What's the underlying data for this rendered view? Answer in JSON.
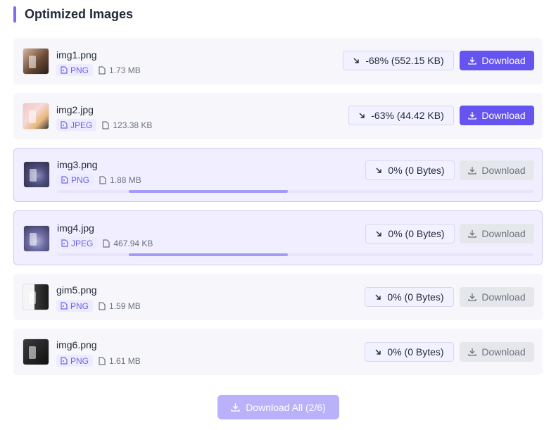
{
  "header": {
    "title": "Optimized Images"
  },
  "images": [
    {
      "name": "img1.png",
      "format": "PNG",
      "size": "1.73 MB",
      "ratio": "-68% (552.15 KB)",
      "download_label": "Download",
      "status": "done",
      "thumb_icon": "image-thumbnail"
    },
    {
      "name": "img2.jpg",
      "format": "JPEG",
      "size": "123.38 KB",
      "ratio": "-63% (44.42 KB)",
      "download_label": "Download",
      "status": "done",
      "thumb_icon": "image-thumbnail"
    },
    {
      "name": "img3.png",
      "format": "PNG",
      "size": "1.88 MB",
      "ratio": "0% (0 Bytes)",
      "download_label": "Download",
      "status": "processing",
      "thumb_icon": "image-thumbnail"
    },
    {
      "name": "img4.jpg",
      "format": "JPEG",
      "size": "467.94 KB",
      "ratio": "0% (0 Bytes)",
      "download_label": "Download",
      "status": "processing",
      "thumb_icon": "image-thumbnail"
    },
    {
      "name": "gim5.png",
      "format": "PNG",
      "size": "1.59 MB",
      "ratio": "0% (0 Bytes)",
      "download_label": "Download",
      "status": "pending",
      "thumb_icon": "image-thumbnail"
    },
    {
      "name": "img6.png",
      "format": "PNG",
      "size": "1.61 MB",
      "ratio": "0% (0 Bytes)",
      "download_label": "Download",
      "status": "pending",
      "thumb_icon": "image-thumbnail"
    }
  ],
  "footer": {
    "download_all_label": "Download All (2/6)"
  },
  "colors": {
    "accent": "#6554ef",
    "accent_light": "#b9b2fb",
    "badge_text": "#6f63e6",
    "processing_bg": "#f1efff"
  },
  "icons": {
    "format": "file-image-icon",
    "size": "file-icon",
    "ratio": "arrow-down-right-icon",
    "download": "download-icon"
  }
}
